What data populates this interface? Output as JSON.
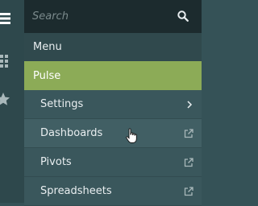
{
  "iconbar": {
    "icons": [
      "hamburger-menu-icon",
      "grid-icon",
      "star-icon"
    ]
  },
  "search": {
    "placeholder": "Search",
    "value": "",
    "icon": "search-icon"
  },
  "menu": {
    "header": "Menu",
    "active_item": "Pulse",
    "items": [
      {
        "label": "Settings",
        "icon": "chevron-right-icon"
      },
      {
        "label": "Dashboards",
        "icon": "external-link-icon"
      },
      {
        "label": "Pivots",
        "icon": "external-link-icon"
      },
      {
        "label": "Spreadsheets",
        "icon": "external-link-icon"
      }
    ]
  },
  "colors": {
    "sidebar_bg": "#3a575c",
    "search_bg": "#1c2b2e",
    "header_bg": "#30494d",
    "active_bg": "#8cab57"
  }
}
